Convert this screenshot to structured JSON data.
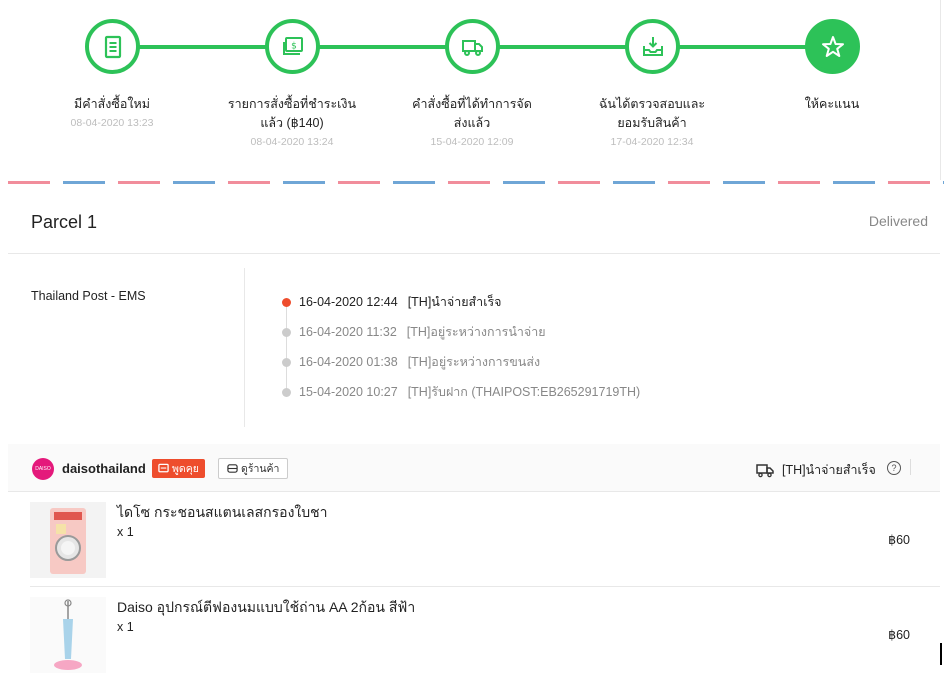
{
  "stepper": {
    "accent": "#2dc258",
    "steps": [
      {
        "title": "มีคำสั่งซื้อใหม่",
        "date": "08-04-2020 13:23",
        "icon": "receipt-icon"
      },
      {
        "title": "รายการสั่งซื้อที่ชำระเงินแล้ว (฿140)",
        "date": "08-04-2020 13:24",
        "icon": "money-icon"
      },
      {
        "title": "คำสั่งซื้อที่ได้ทำการจัดส่งแล้ว",
        "date": "15-04-2020 12:09",
        "icon": "truck-icon"
      },
      {
        "title": "ฉันได้ตรวจสอบและยอมรับสินค้า",
        "date": "17-04-2020 12:34",
        "icon": "inbox-download-icon"
      },
      {
        "title": "ให้คะแนน",
        "date": "",
        "icon": "star-icon"
      }
    ]
  },
  "parcel": {
    "title": "Parcel 1",
    "status": "Delivered",
    "carrier": "Thailand Post - EMS",
    "events": [
      {
        "time": "16-04-2020 12:44",
        "desc": "[TH]นำจ่ายสำเร็จ"
      },
      {
        "time": "16-04-2020 11:32",
        "desc": "[TH]อยู่ระหว่างการนำจ่าย"
      },
      {
        "time": "16-04-2020 01:38",
        "desc": "[TH]อยู่ระหว่างการขนส่ง"
      },
      {
        "time": "15-04-2020 10:27",
        "desc": "[TH]รับฝาก (THAIPOST:EB265291719TH)"
      }
    ]
  },
  "shop": {
    "avatar_text": "DAISO",
    "name": "daisothailand",
    "chat_label": "พูดคุย",
    "view_label": "ดูร้านค้า",
    "delivery_status": "[TH]นำจ่ายสำเร็จ",
    "help": "?"
  },
  "products": [
    {
      "name": "ไดโซ กระชอนสแตนเลสกรองใบชา",
      "qty": "x 1",
      "price": "฿60"
    },
    {
      "name": "Daiso อุปกรณ์ตีฟองนมแบบใช้ถ่าน AA 2ก้อน สีฟ้า",
      "qty": "x 1",
      "price": "฿60"
    }
  ]
}
